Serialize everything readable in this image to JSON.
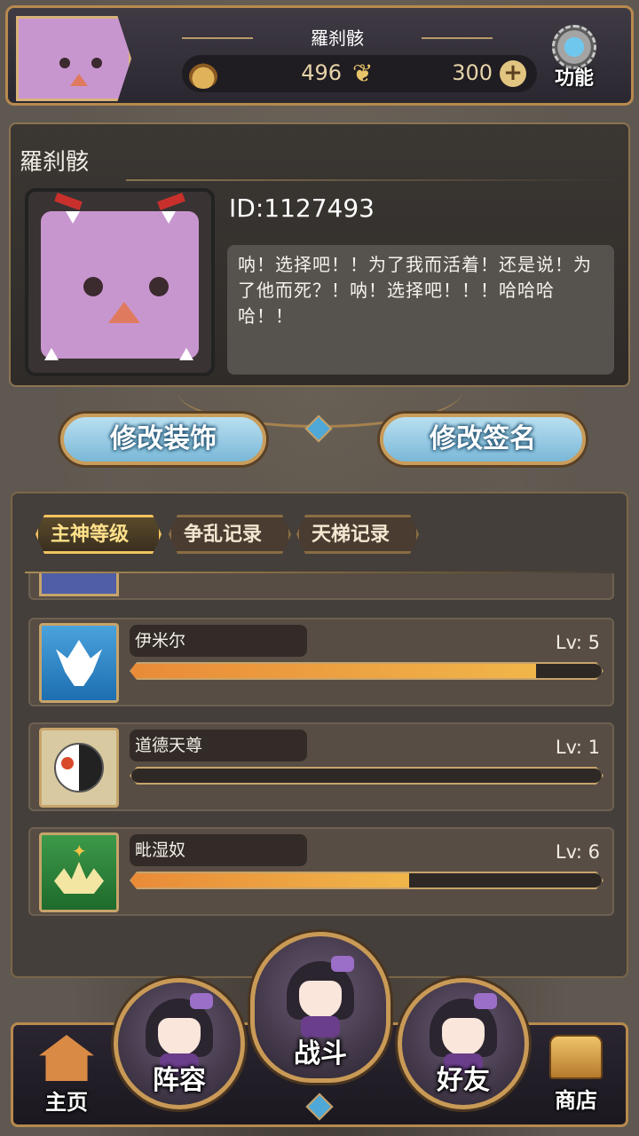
{
  "header": {
    "player_name": "羅刹骸",
    "currency_a": "496",
    "currency_b": "300",
    "function_label": "功能"
  },
  "profile": {
    "name": "羅刹骸",
    "id_text": "ID:1127493",
    "signature": "呐！选择吧！！为了我而活着！还是说！为了他而死？！呐！选择吧！！！哈哈哈哈！！"
  },
  "actions": {
    "edit_decor": "修改装饰",
    "edit_signature": "修改签名"
  },
  "tabs": [
    {
      "label": "主神等级",
      "active": true
    },
    {
      "label": "争乱记录",
      "active": false
    },
    {
      "label": "天梯记录",
      "active": false
    }
  ],
  "gods": [
    {
      "name": "伊米尔",
      "level": "Lv: 5",
      "progress": 0.86,
      "icon": "ymir-icon"
    },
    {
      "name": "道德天尊",
      "level": "Lv: 1",
      "progress": 0.0,
      "icon": "taiji-icon"
    },
    {
      "name": "毗湿奴",
      "level": "Lv: 6",
      "progress": 0.59,
      "icon": "lotus-icon"
    }
  ],
  "nav": {
    "home": "主页",
    "lineup": "阵容",
    "battle": "战斗",
    "friends": "好友",
    "shop": "商店"
  },
  "colors": {
    "accent_gold": "#c89c5a",
    "progress_orange": "#e98b38",
    "button_blue": "#7ab8d8",
    "avatar_pink": "#c896cf"
  }
}
